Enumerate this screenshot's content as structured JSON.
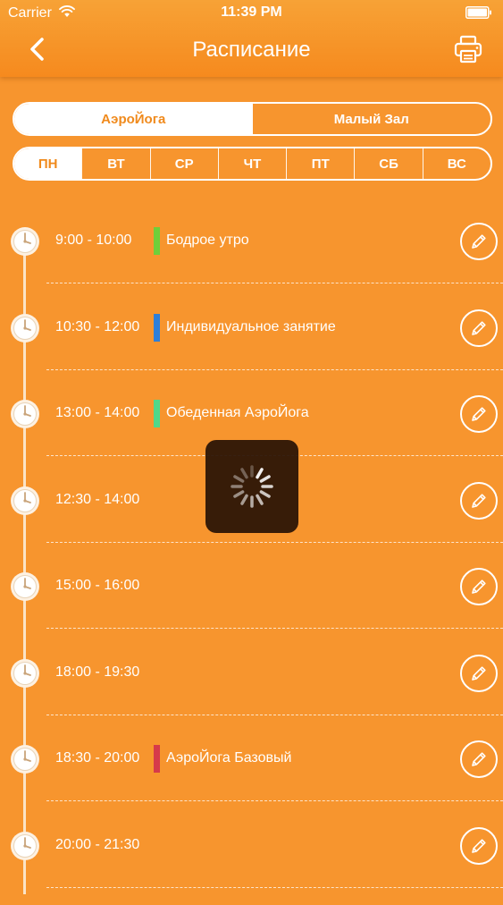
{
  "status_bar": {
    "carrier": "Carrier",
    "time": "11:39 PM",
    "wifi_icon": "wifi-icon",
    "battery_icon": "battery-icon"
  },
  "nav": {
    "title": "Расписание",
    "back_icon": "chevron-left-icon",
    "print_icon": "printer-icon"
  },
  "halls": {
    "selected": "АэроЙога",
    "items": [
      "АэроЙога",
      "Малый Зал"
    ]
  },
  "days": {
    "selected": "ПН",
    "items": [
      "ПН",
      "ВТ",
      "СР",
      "ЧТ",
      "ПТ",
      "СБ",
      "ВС"
    ]
  },
  "schedule": [
    {
      "time": "9:00 - 10:00",
      "name": "Бодрое утро",
      "color": "#6fcf3a"
    },
    {
      "time": "10:30 - 12:00",
      "name": "Индивидуальное занятие",
      "color": "#2f7fd8"
    },
    {
      "time": "13:00 - 14:00",
      "name": "Обеденная АэроЙога",
      "color": "#4fd88a"
    },
    {
      "time": "12:30 - 14:00",
      "name": "",
      "color": ""
    },
    {
      "time": "15:00 - 16:00",
      "name": "",
      "color": ""
    },
    {
      "time": "18:00 - 19:30",
      "name": "",
      "color": ""
    },
    {
      "time": "18:30 - 20:00",
      "name": "АэроЙога Базовый",
      "color": "#d63a4a"
    },
    {
      "time": "20:00 - 21:30",
      "name": "",
      "color": ""
    }
  ],
  "colors": {
    "background": "#f7952e",
    "accent_text": "#f08a1c",
    "timeline": "#fbe3c6",
    "loading_overlay": "#281205"
  },
  "icons": {
    "row_clock": "clock-icon",
    "row_edit": "pencil-icon",
    "loading": "spinner-icon"
  }
}
